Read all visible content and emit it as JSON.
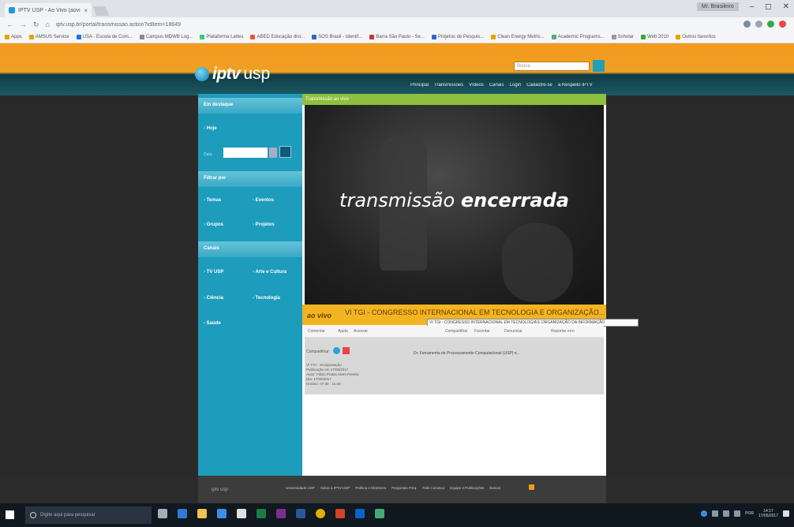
{
  "browser": {
    "tab_title": "IPTV USP - Ao Vivo (aovi...",
    "tab_close": "×",
    "url": "iptv.usp.br/portal/transmissao.action?idItem=18649",
    "user_button": "Mr. Brasileiro",
    "window_controls": [
      "–",
      "◻",
      "✕"
    ],
    "bookmarks": [
      "Apps",
      "AMSUS Service",
      "USA - Escola de Com...",
      "Campus MDWB Log...",
      "Plataforma Lattes",
      "ABED Educação dist...",
      "SOS Brasil - Identif...",
      "Barra São Paulo - Se...",
      "Projetos de Pesquis...",
      "Clean Energy Metric...",
      "Academic Programs...",
      "Scholar",
      "Web 2010",
      "Outros favoritos"
    ]
  },
  "site": {
    "brand": "iptv",
    "brand_suffix": "usp",
    "search_placeholder": "Busca",
    "nav": [
      "Principal",
      "Transmissões",
      "Vídeos",
      "Canais",
      "Login",
      "Cadastre-se",
      "a Respeito IPTV"
    ],
    "sidebar": {
      "sections": [
        "Em destaque",
        "Filtrar por",
        "Canais"
      ],
      "items_destaque": [
        "Hoje"
      ],
      "data_label": "Data",
      "items_filtrar": [
        "Temas",
        "Eventos",
        "Grupos",
        "Projetos"
      ],
      "items_canais": [
        "TV USP",
        "Arte e Cultura",
        "Ciência",
        "Tecnologia",
        "Saúde"
      ]
    },
    "content_header": "Transmissão ao vivo",
    "video_message": "transmissão",
    "video_message_bold": "encerrada",
    "live_label": "ao vivo",
    "event_title": "VI TGI - CONGRESSO INTERNACIONAL EM TECNOLOGIA E ORGANIZAÇÃO...",
    "tooltip": "VI TGI - CONGRESSO INTERNACIONAL EM TECNOLOGIA E ORGANIZAÇÃO DA INFORMAÇÃO",
    "actions": [
      "Comentar",
      "Ajuda",
      "Acessar",
      "Compartilhar",
      "Favoritar",
      "Denunciar",
      "Reportar erro"
    ],
    "share_label": "Compartilhar:",
    "organizer": "Dr. Ferramenta de Processamento Computacional (USP) e...",
    "meta_lines": [
      "VI TGI - vivo/gravação",
      "Publicação em 17/05/2017",
      "Autor: Fábio Pratas Alves Pereira",
      "Dia: 17/05/2017",
      "Horário: 07:30 - 11:30"
    ],
    "footer_logo": "iptv usp",
    "footer_links": [
      "Universidade USP",
      "Sobre a IPTV-USP",
      "Política e Diretrizes",
      "Perguntas Freq.",
      "Fale Conosco",
      "Equipe e Publicações",
      "Buscar"
    ]
  },
  "taskbar": {
    "search_placeholder": "Digite aqui para pesquisar",
    "time": "14:17",
    "date": "17/05/2017",
    "lang": "POR"
  },
  "colors": {
    "header_orange": "#f29a1e",
    "sidebar_teal": "#1d9cbb",
    "live_bar": "#f2b420",
    "green_header": "#8fbf3f"
  }
}
